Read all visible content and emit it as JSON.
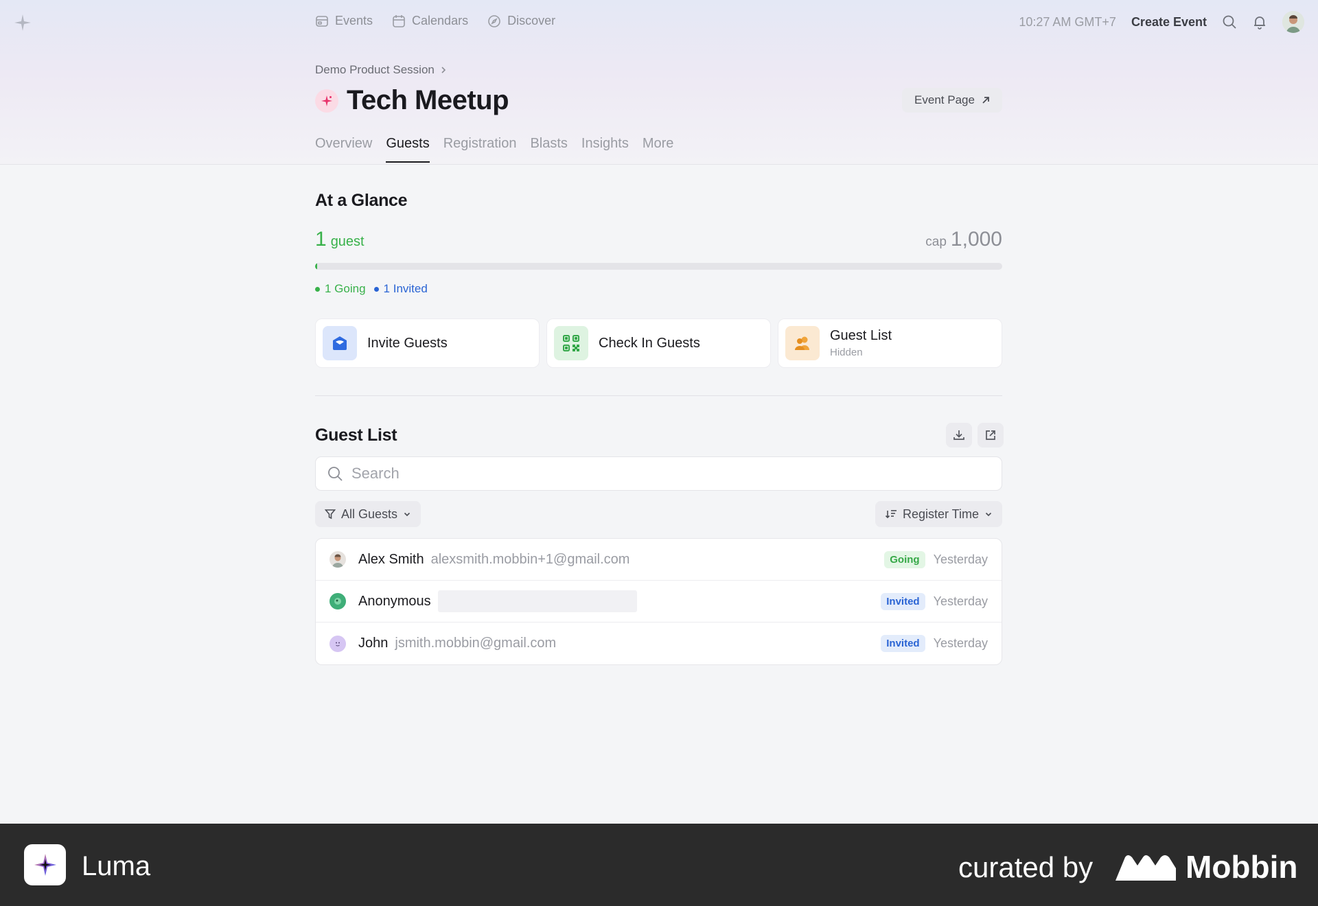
{
  "nav": {
    "links": [
      {
        "label": "Events",
        "icon": "events-icon"
      },
      {
        "label": "Calendars",
        "icon": "calendar-icon"
      },
      {
        "label": "Discover",
        "icon": "compass-icon"
      }
    ],
    "time": "10:27 AM GMT+7",
    "create_label": "Create Event"
  },
  "header": {
    "breadcrumb": "Demo Product Session",
    "title": "Tech Meetup",
    "event_page_label": "Event Page",
    "tabs": [
      "Overview",
      "Guests",
      "Registration",
      "Blasts",
      "Insights",
      "More"
    ],
    "active_tab": "Guests"
  },
  "glance": {
    "title": "At a Glance",
    "guest_num": "1",
    "guest_label": "guest",
    "cap_label": "cap",
    "cap_num": "1,000",
    "progress_fraction": 0.001,
    "legend": [
      {
        "label": "1 Going",
        "color": "#38b14a"
      },
      {
        "label": "1 Invited",
        "color": "#2a64d4"
      }
    ]
  },
  "cards": [
    {
      "label": "Invite Guests",
      "sub": ""
    },
    {
      "label": "Check In Guests",
      "sub": ""
    },
    {
      "label": "Guest List",
      "sub": "Hidden"
    }
  ],
  "guest_list": {
    "title": "Guest List",
    "search_placeholder": "Search",
    "filter_label": "All Guests",
    "sort_label": "Register Time",
    "rows": [
      {
        "name": "Alex Smith",
        "email": "alexsmith.mobbin+1@gmail.com",
        "status": "Going",
        "time": "Yesterday"
      },
      {
        "name": "Anonymous",
        "email": "",
        "status": "Invited",
        "time": "Yesterday"
      },
      {
        "name": "John",
        "email": "jsmith.mobbin@gmail.com",
        "status": "Invited",
        "time": "Yesterday"
      }
    ]
  },
  "footer": {
    "app_name": "Luma",
    "curated": "curated by",
    "brand": "Mobbin"
  },
  "colors": {
    "accent_green": "#38b14a",
    "accent_blue": "#2a64d4",
    "footer_bg": "#2b2b2b"
  }
}
